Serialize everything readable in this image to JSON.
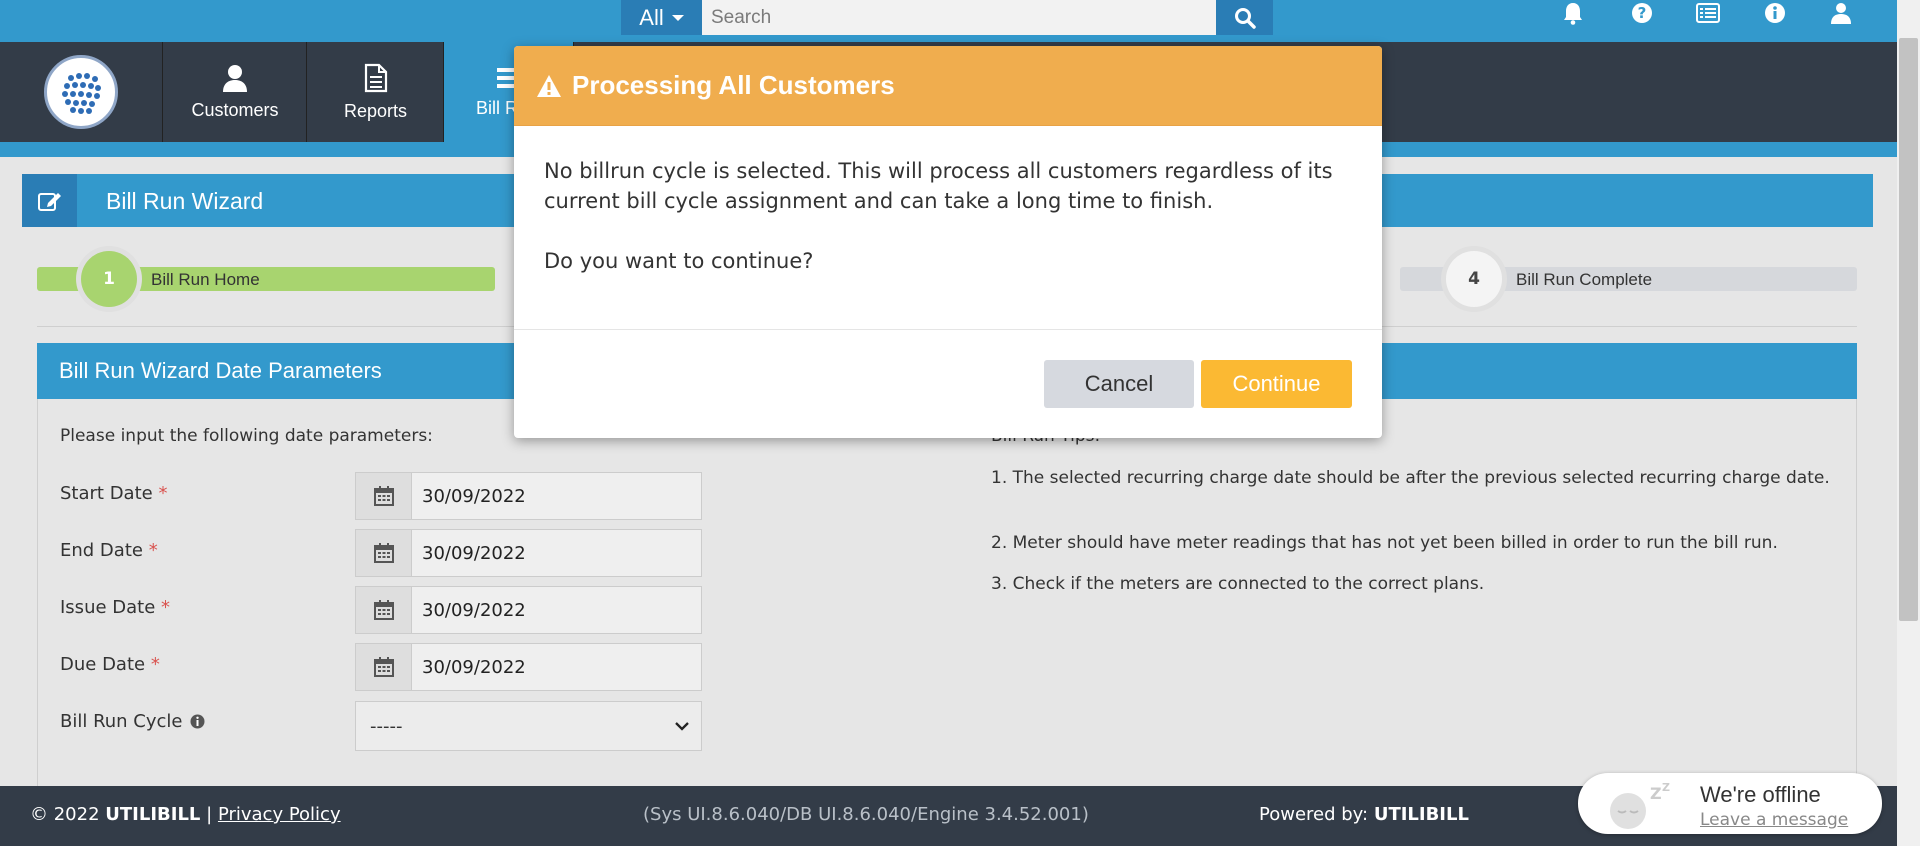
{
  "topbar": {
    "search_scope": "All",
    "search_placeholder": "Search",
    "icons": [
      "bell-icon",
      "question-icon",
      "list-icon",
      "info-icon",
      "user-icon"
    ]
  },
  "nav": {
    "items": [
      {
        "label": "Customers",
        "icon": "user-icon"
      },
      {
        "label": "Reports",
        "icon": "document-icon"
      },
      {
        "label": "Bill R",
        "icon": "list-icon"
      }
    ]
  },
  "wizard": {
    "title": "Bill Run Wizard",
    "steps": [
      {
        "number": "1",
        "label": "Bill Run Home"
      },
      {
        "number": "4",
        "label": "Bill Run Complete"
      }
    ]
  },
  "params": {
    "title": "Bill Run Wizard Date Parameters",
    "instruction": "Please input the following date parameters:",
    "fields": [
      {
        "label": "Start Date",
        "value": "30/09/2022"
      },
      {
        "label": "End Date",
        "value": "30/09/2022"
      },
      {
        "label": "Issue Date",
        "value": "30/09/2022"
      },
      {
        "label": "Due Date",
        "value": "30/09/2022"
      }
    ],
    "cycle_label": "Bill Run Cycle",
    "cycle_value": "-----",
    "required_marker": "*"
  },
  "tips": {
    "title": "Bill Run Tips:",
    "items": [
      "1. The selected recurring charge date should be after the previous selected recurring charge date.",
      "2. Meter should have meter readings that has not yet been billed in order to run the bill run.",
      "3. Check if the meters are connected to the correct plans."
    ]
  },
  "modal": {
    "title": "Processing All Customers",
    "message": "No billrun cycle is selected. This will process all customers regardless of its current bill cycle assignment and can take a long time to finish.",
    "question": "Do you want to continue?",
    "cancel_label": "Cancel",
    "continue_label": "Continue"
  },
  "footer": {
    "copyright": "© 2022",
    "company": "UTILIBILL",
    "separator": "|",
    "privacy_label": "Privacy Policy",
    "version": "(Sys UI.8.6.040/DB UI.8.6.040/Engine 3.4.52.001)",
    "powered_prefix": "Powered by:",
    "powered_company": "UTILIBILL"
  },
  "chat": {
    "status": "We're offline",
    "link": "Leave a message"
  },
  "colors": {
    "primary": "#3399cc",
    "nav_dark": "#333c48",
    "warning_header": "#f0ad4e",
    "continue_button": "#fbb933",
    "step_active": "#a8d46f"
  }
}
